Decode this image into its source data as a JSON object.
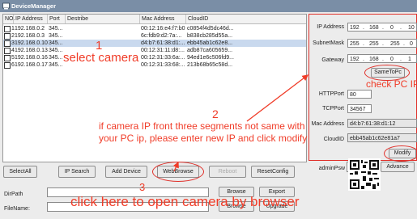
{
  "window": {
    "title": "DeviceManager"
  },
  "columns": [
    "NO.",
    "IP Address",
    "Port",
    "Destribe",
    "Mac Address",
    "CloudID"
  ],
  "devices": [
    {
      "no": "1",
      "ip": "192.168.0.2",
      "port": "345...",
      "mac": "00:12:16:e4:f7:b0",
      "cloud": "c0854f4d5dc46d..."
    },
    {
      "no": "2",
      "ip": "192.168.0.3",
      "port": "345...",
      "mac": "6c:fdb9:d2:7a:...",
      "cloud": "b838cb285d55a..."
    },
    {
      "no": "3",
      "ip": "192.168.0.10",
      "port": "345...",
      "mac": "d4:b7:61:38:d1:...",
      "cloud": "ebb45ab1c62e8..."
    },
    {
      "no": "4",
      "ip": "192.168.0.13",
      "port": "345...",
      "mac": "00:12:31:11:d8:...",
      "cloud": "adb87ca605659..."
    },
    {
      "no": "5",
      "ip": "192.168.0.16",
      "port": "345...",
      "mac": "00:12:31:33:6a:...",
      "cloud": "94ed1e6c506fd9..."
    },
    {
      "no": "6",
      "ip": "192.168.0.17",
      "port": "345...",
      "mac": "00:12:31:33:68:...",
      "cloud": "213b68b65c58d..."
    }
  ],
  "panel": {
    "ip_label": "IP Address",
    "ip": [
      "192",
      "168",
      "0",
      "10"
    ],
    "mask_label": "SubnetMask",
    "mask": [
      "255",
      "255",
      "255",
      "0"
    ],
    "gw_label": "Gateway",
    "gw": [
      "192",
      "168",
      "0",
      "1"
    ],
    "sametopc": "SameToPc",
    "http_label": "HTTPPort",
    "http": "80",
    "tcp_label": "TCPPort",
    "tcp": "34567",
    "mac_label": "Mac Address",
    "mac": "d4:b7:61:38:d1:12",
    "cloud_label": "CloudID",
    "cloud": "ebb45ab1c62e81a7",
    "modify": "Modify",
    "pwd_label": "adminPsw",
    "advance": "Advance"
  },
  "toolbar": {
    "select_all": "SelectAll",
    "ip_search": "IP Search",
    "add_device": "Add Device",
    "web_browse": "WebBrowse",
    "reboot": "Reboot",
    "reset_config": "ResetConfig",
    "dir_path": "DirPath",
    "file_name": "FileName:",
    "browse": "Browse",
    "export": "Export",
    "browse2": "Browse",
    "upgrade": "Upgrade"
  },
  "annotations": {
    "n1": "1",
    "a1": "select camera",
    "n2": "2",
    "a2": "if camera IP front three segments not same with",
    "a2b": "your PC ip, please enter new IP and click modify",
    "a_pc": "check PC IP",
    "n3": "3",
    "a3": "click here to open camera by browser"
  },
  "colors": {
    "annotation": "#f03c28",
    "titlebar": "#7a8ea6",
    "selected_row": "#c9d9ee"
  }
}
